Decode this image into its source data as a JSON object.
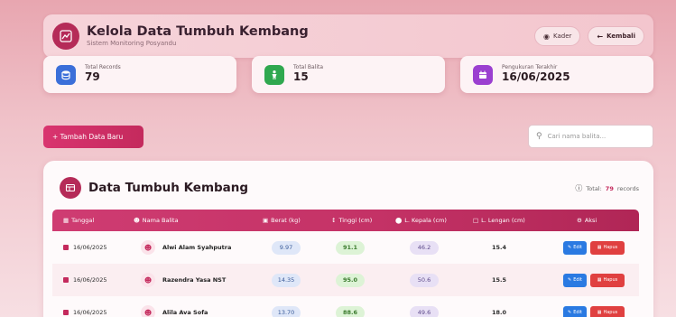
{
  "header": {
    "title": "Kelola Data Tumbuh Kembang",
    "subtitle": "Sistem Monitoring Posyandu",
    "kader_label": "Kader",
    "kembali_label": "Kembali"
  },
  "stats": [
    {
      "label": "Total Records",
      "value": "79",
      "color": "#3b6fd9",
      "icon": "database-icon"
    },
    {
      "label": "Total Balita",
      "value": "15",
      "color": "#2fa84f",
      "icon": "child-icon"
    },
    {
      "label": "Pengukuran Terakhir",
      "value": "16/06/2025",
      "color": "#9b3fd0",
      "icon": "calendar-icon"
    }
  ],
  "actions": {
    "add_label": "+ Tambah Data Baru",
    "search_placeholder": "Cari nama balita..."
  },
  "table": {
    "title": "Data Tumbuh Kembang",
    "total_prefix": "Total:",
    "total_value": "79",
    "total_suffix": "records",
    "columns": [
      "Tanggal",
      "Nama Balita",
      "Berat (kg)",
      "Tinggi (cm)",
      "L. Kepala (cm)",
      "L. Lengan (cm)",
      "Aksi"
    ],
    "edit_label": "Edit",
    "hapus_label": "Hapus",
    "rows": [
      {
        "tanggal": "16/06/2025",
        "nama": "Alwi Alam Syahputra",
        "berat": "9.97",
        "tinggi": "91.1",
        "kepala": "46.2",
        "lengan": "15.4"
      },
      {
        "tanggal": "16/06/2025",
        "nama": "Razendra Yasa NST",
        "berat": "14.35",
        "tinggi": "95.0",
        "kepala": "50.6",
        "lengan": "15.5"
      },
      {
        "tanggal": "16/06/2025",
        "nama": "Alila Ava Sofa",
        "berat": "13.70",
        "tinggi": "88.6",
        "kepala": "49.6",
        "lengan": "18.0"
      }
    ]
  },
  "colors": {
    "primary": "#c42a5d",
    "edit": "#2a7ae2",
    "hapus": "#e04040"
  }
}
